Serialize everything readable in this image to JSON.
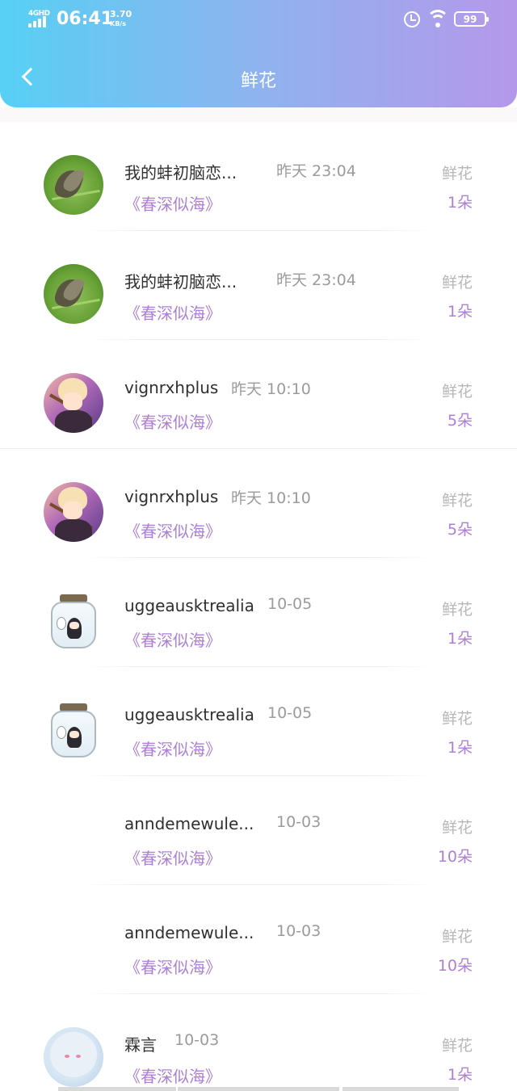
{
  "status_bar": {
    "network": "4GHD",
    "time": "06:41",
    "speed_value": "3.70",
    "speed_unit": "KB/s",
    "battery": "99",
    "icons": [
      "signal-icon",
      "alarm-icon",
      "wifi-icon",
      "battery-icon"
    ]
  },
  "header": {
    "title": "鲜花",
    "back_icon": "chevron-left-icon",
    "gradient": [
      "#56d0f4",
      "#b598ea"
    ]
  },
  "colors": {
    "accent": "#ad7fd9",
    "muted": "#b7b7b7"
  },
  "records": [
    {
      "name": "我的蚌初脑恋...",
      "time": "昨天 23:04",
      "book": "《春深似海》",
      "gift": "鲜花",
      "count": "1朵",
      "avatar": "butterfly"
    },
    {
      "name": "我的蚌初脑恋...",
      "time": "昨天 23:04",
      "book": "《春深似海》",
      "gift": "鲜花",
      "count": "1朵",
      "avatar": "butterfly"
    },
    {
      "name": "vignrxhplus",
      "time": "昨天 10:10",
      "book": "《春深似海》",
      "gift": "鲜花",
      "count": "5朵",
      "avatar": "anime"
    },
    {
      "name": "vignrxhplus",
      "time": "昨天 10:10",
      "book": "《春深似海》",
      "gift": "鲜花",
      "count": "5朵",
      "avatar": "anime"
    },
    {
      "name": "uggeausktrealia",
      "time": "10-05",
      "book": "《春深似海》",
      "gift": "鲜花",
      "count": "1朵",
      "avatar": "jar"
    },
    {
      "name": "uggeausktrealia",
      "time": "10-05",
      "book": "《春深似海》",
      "gift": "鲜花",
      "count": "1朵",
      "avatar": "jar"
    },
    {
      "name": "anndemewule...",
      "time": "10-03",
      "book": "《春深似海》",
      "gift": "鲜花",
      "count": "10朵",
      "avatar": "blank"
    },
    {
      "name": "anndemewule...",
      "time": "10-03",
      "book": "《春深似海》",
      "gift": "鲜花",
      "count": "10朵",
      "avatar": "blank"
    },
    {
      "name": "霖言",
      "time": "10-03",
      "book": "《春深似海》",
      "gift": "鲜花",
      "count": "1朵",
      "avatar": "pale"
    }
  ]
}
